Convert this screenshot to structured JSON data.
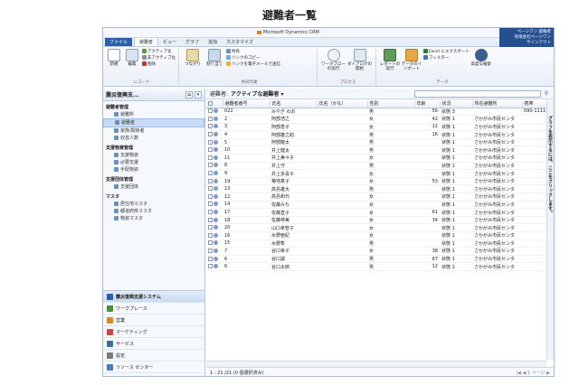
{
  "page_title": "避難者一覧",
  "brand": "Microsoft Dynamics CRM",
  "user": {
    "name": "ペーシワン 鹿権者",
    "org": "有限会社ペーシワン",
    "signout": "サインアウト"
  },
  "tabs": [
    {
      "label": "ファイル"
    },
    {
      "label": "避難者"
    },
    {
      "label": "ビュー"
    },
    {
      "label": "グラフ"
    },
    {
      "label": "追加"
    },
    {
      "label": "カスタマイズ"
    }
  ],
  "ribbon": {
    "new": "新規",
    "edit": "編集",
    "activate": "アクティブ化",
    "deactivate": "非アクティブ化",
    "delete": "削除",
    "group_record": "レコード",
    "follow": "つながり",
    "assign": "割り当て",
    "share": "共有",
    "copy_link": "リンクのコピー",
    "send_link": "リンクを電子メールで送信",
    "group_collab": "共同作業",
    "workflow": "ワークフローの実行",
    "dialog": "ダイアログの開始",
    "group_process": "プロセス",
    "report": "レポートの実行",
    "import": "データのインポート",
    "export": "Excel にエクスポート",
    "filter": "フィルター",
    "adv_find": "高度な検索",
    "group_data": "データ"
  },
  "nav": {
    "title": "震災復興支...",
    "sections": [
      {
        "label": "避難者管理",
        "items": [
          "避難所",
          "避難者",
          "家族/関係者",
          "収容人数"
        ]
      },
      {
        "label": "支援物資管理",
        "items": [
          "支援物資",
          "必要支援",
          "手配物資"
        ]
      },
      {
        "label": "支援団体管理",
        "items": [
          "支援団体"
        ]
      },
      {
        "label": "マスタ",
        "items": [
          "居住地マスタ",
          "都道府県マスタ",
          "物資マスタ"
        ]
      }
    ],
    "selected": "避難者",
    "workspaces": [
      "震災復興支援システム",
      "ワークプレース",
      "営業",
      "マーケティング",
      "サービス",
      "設定",
      "リソース センター"
    ]
  },
  "view": {
    "label": "避難者:",
    "name": "アクティブな避難者"
  },
  "columns": [
    "避難者番号",
    "氏名",
    "氏名（かな）",
    "性別",
    "年齢",
    "状況",
    "所在避難所",
    "携帯",
    "メール"
  ],
  "rows": [
    [
      "022",
      "みやぎ わお",
      "",
      "男",
      "56",
      "状態 3",
      "",
      "090-1111-1111",
      ""
    ],
    [
      "2",
      "阿部浩之",
      "",
      "女",
      "42",
      "状態 1",
      "さかがみ市民センタ",
      "",
      ""
    ],
    [
      "3",
      "阿部恵子",
      "",
      "女",
      "12",
      "状態 1",
      "さかがみ市民センタ",
      "",
      ""
    ],
    [
      "4",
      "阿部雄之助",
      "",
      "男",
      "16",
      "状態 1",
      "さかがみ市民センタ",
      "",
      ""
    ],
    [
      "5",
      "阿部龍太",
      "",
      "男",
      "",
      "状態 1",
      "さかがみ市民センタ",
      "",
      ""
    ],
    [
      "10",
      "井上健太",
      "",
      "男",
      "",
      "状態 1",
      "さかがみ市民センタ",
      "",
      ""
    ],
    [
      "11",
      "井上美々子",
      "",
      "女",
      "",
      "状態 1",
      "さかがみ市民センタ",
      "",
      ""
    ],
    [
      "8",
      "井上守",
      "",
      "男",
      "",
      "状態 1",
      "さかがみ市民センタ",
      "",
      ""
    ],
    [
      "9",
      "井上多喜子",
      "",
      "女",
      "",
      "状態 1",
      "さかがみ市民センタ",
      "",
      ""
    ],
    [
      "19",
      "菊地真子",
      "",
      "女",
      "53",
      "状態 1",
      "さかがみ市民センタ",
      "",
      ""
    ],
    [
      "13",
      "高島雄大",
      "",
      "男",
      "",
      "状態 1",
      "さかがみ市民センタ",
      "",
      ""
    ],
    [
      "12",
      "高島和代",
      "",
      "女",
      "",
      "状態 1",
      "さかがみ市民センタ",
      "",
      ""
    ],
    [
      "14",
      "佐藤みち",
      "",
      "女",
      "",
      "状態 1",
      "さかがみ市民センタ",
      "",
      ""
    ],
    [
      "17",
      "佐藤直子",
      "",
      "女",
      "61",
      "状態 1",
      "さかがみ市民センタ",
      "",
      ""
    ],
    [
      "18",
      "佐藤恭美",
      "",
      "女",
      "34",
      "状態 1",
      "さかがみ市民センタ",
      "",
      ""
    ],
    [
      "20",
      "山口幸智子",
      "",
      "女",
      "",
      "状態 1",
      "さかがみ市民センタ",
      "",
      ""
    ],
    [
      "16",
      "水野亜紀",
      "",
      "女",
      "",
      "状態 1",
      "さかがみ市民センタ",
      "",
      ""
    ],
    [
      "15",
      "水野隼",
      "",
      "男",
      "",
      "状態 1",
      "さかがみ市民センタ",
      "",
      ""
    ],
    [
      "7",
      "谷口幸子",
      "",
      "女",
      "38",
      "状態 1",
      "さかがみ市民センタ",
      "",
      ""
    ],
    [
      "6",
      "谷口誠",
      "",
      "男",
      "67",
      "状態 1",
      "さかがみ市民センタ",
      "",
      ""
    ],
    [
      "6",
      "谷口太郎",
      "",
      "男",
      "12",
      "状態 1",
      "さかがみ市民センタ",
      "",
      ""
    ]
  ],
  "status": {
    "count": "1 - 21 /21 (0 個選択済み)",
    "pager": "|◀ ◀ 1 ページ ▶"
  },
  "side_hint": "グラフを表示するには、ここをクリックします。",
  "colors": {
    "accent": "#2a5ea8",
    "selected": "#c9dcf3"
  }
}
